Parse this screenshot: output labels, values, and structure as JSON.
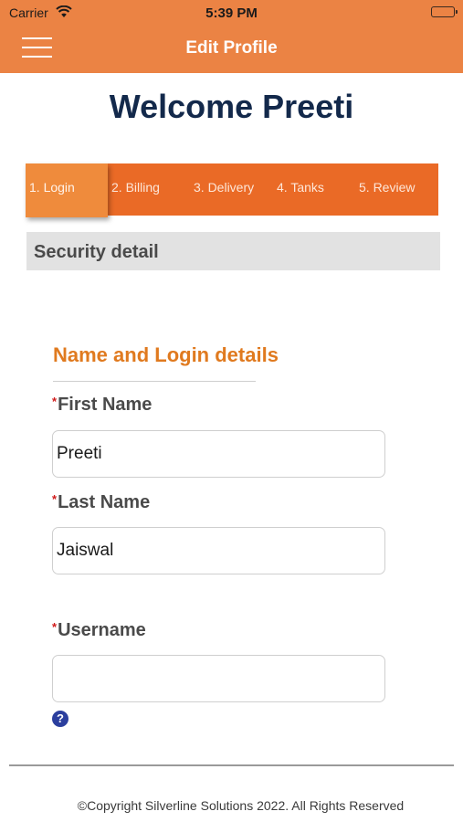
{
  "status_bar": {
    "carrier": "Carrier",
    "time": "5:39 PM"
  },
  "nav": {
    "title": "Edit Profile",
    "menu_icon": "hamburger-menu-icon"
  },
  "welcome": "Welcome Preeti",
  "steps": [
    {
      "label": "1. Login",
      "active": true
    },
    {
      "label": "2. Billing",
      "active": false
    },
    {
      "label": "3. Delivery",
      "active": false
    },
    {
      "label": "4. Tanks",
      "active": false
    },
    {
      "label": "5. Review",
      "active": false
    }
  ],
  "section_title": "Security detail",
  "form": {
    "heading": "Name and Login details",
    "required_marker": "*",
    "first_name": {
      "label": "First Name",
      "value": "Preeti"
    },
    "last_name": {
      "label": "Last Name",
      "value": "Jaiswal"
    },
    "username": {
      "label": "Username",
      "value": ""
    },
    "help_icon": "question-circle-icon",
    "help_glyph": "?"
  },
  "footer": "©Copyright Silverline Solutions 2022. All Rights Reserved",
  "colors": {
    "nav_bg": "#eb8344",
    "tabs_bg": "#ea6a26",
    "active_tab": "#ef8b3c",
    "heading_navy": "#13294b",
    "accent_orange": "#e07a1f",
    "required_red": "#d01a1a",
    "help_blue": "#2b3f9e"
  }
}
